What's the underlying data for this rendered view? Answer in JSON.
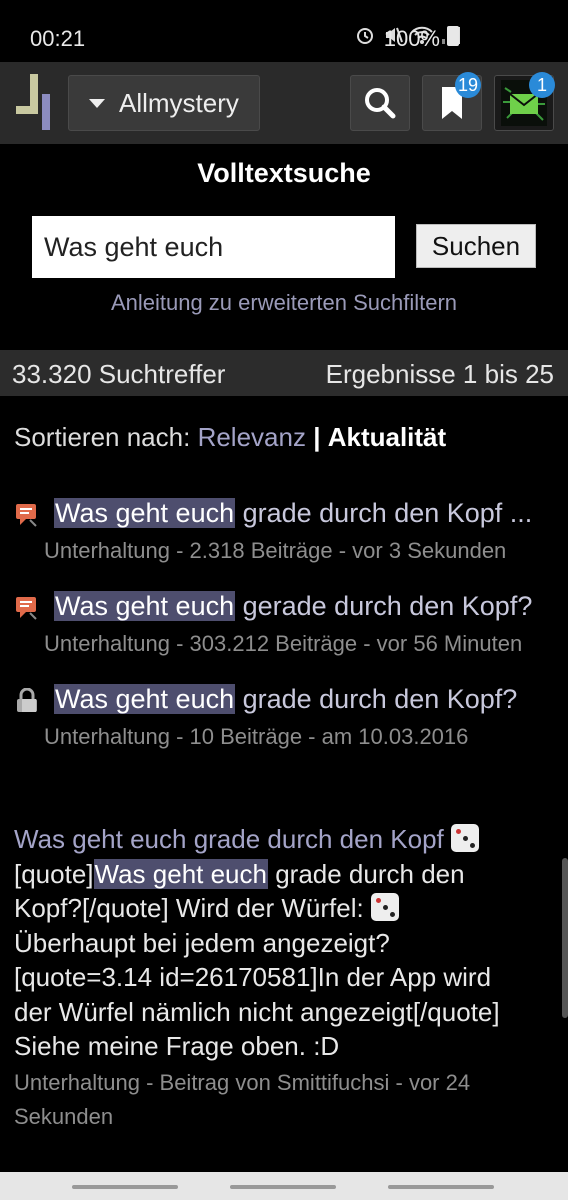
{
  "status_bar": {
    "time": "00:21",
    "battery": "100%"
  },
  "top_bar": {
    "site_name": "Allmystery",
    "bookmarks_count": "19",
    "messages_count": "1"
  },
  "search": {
    "title": "Volltextsuche",
    "query": "Was geht euch",
    "button_label": "Suchen",
    "help_link": "Anleitung zu erweiterten Suchfiltern"
  },
  "results_bar": {
    "count": "33.320 Suchtreffer",
    "range": "Ergebnisse 1 bis 25"
  },
  "sort": {
    "label": "Sortieren nach:",
    "relevance": "Relevanz",
    "separator": "|",
    "recency": "Aktualität"
  },
  "results": [
    {
      "highlight": "Was geht euch",
      "rest": " grade durch den Kopf ...",
      "meta": "Unterhaltung - 2.318 Beiträge - vor 3 Sekunden",
      "icon": "comment-icon"
    },
    {
      "highlight": "Was geht euch",
      "rest": " gerade durch den Kopf?",
      "meta": "Unterhaltung - 303.212 Beiträge - vor 56 Minuten",
      "icon": "comment-icon"
    },
    {
      "highlight": "Was geht euch",
      "rest": " grade durch den Kopf?",
      "meta": "Unterhaltung - 10 Beiträge - am 10.03.2016",
      "icon": "lock-icon"
    }
  ],
  "post": {
    "title": "Was geht euch grade durch den Kopf",
    "body_pre": "[quote]",
    "body_highlight": "Was geht euch",
    "body_line1_rest": " grade durch den",
    "body_line2": "Kopf?[/quote] Wird der Würfel:",
    "body_line3": "Überhaupt bei jedem angezeigt?",
    "body_line4": "[quote=3.14 id=26170581]In der App wird",
    "body_line5": "der Würfel nämlich nicht angezeigt[/quote]",
    "body_line6": "Siehe meine Frage oben. :D",
    "meta_line1": "Unterhaltung - Beitrag von Smittifuchsi - vor 24",
    "meta_line2": "Sekunden"
  },
  "colors": {
    "background": "#000000",
    "topbar": "#2a2a2a",
    "highlight": "#4e4e6e",
    "link": "#a4a4c8",
    "badge": "#2a8ad8",
    "comment_icon": "#e06a4a"
  }
}
